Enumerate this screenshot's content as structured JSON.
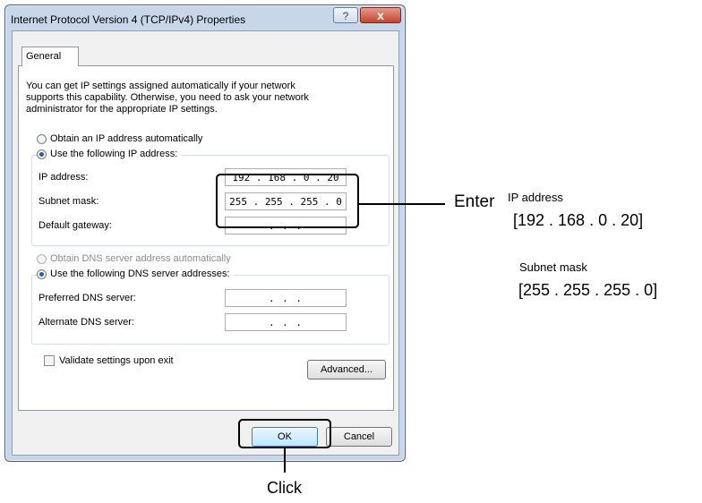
{
  "window": {
    "title": "Internet Protocol Version 4 (TCP/IPv4) Properties",
    "help_glyph": "?",
    "close_glyph": "x"
  },
  "tab": {
    "label": "General"
  },
  "description": "You can get IP settings assigned automatically if your network supports this capability. Otherwise, you need to ask your network administrator for the appropriate IP settings.",
  "ip": {
    "auto_label": "Obtain an IP address automatically",
    "manual_label": "Use the following IP address:",
    "address_label": "IP address:",
    "address_value": "192 . 168 .  0  . 20",
    "mask_label": "Subnet mask:",
    "mask_value": "255 . 255 . 255 .  0",
    "gateway_label": "Default gateway:",
    "gateway_value": ".     .     ."
  },
  "dns": {
    "auto_label": "Obtain DNS server address automatically",
    "manual_label": "Use the following DNS server addresses:",
    "preferred_label": "Preferred DNS server:",
    "preferred_value": ".     .     .",
    "alternate_label": "Alternate DNS server:",
    "alternate_value": ".     .     ."
  },
  "validate_label": "Validate settings upon exit",
  "buttons": {
    "advanced": "Advanced...",
    "ok": "OK",
    "cancel": "Cancel"
  },
  "annotations": {
    "enter": "Enter",
    "ip_heading": "IP address",
    "ip_value": "[192 . 168 . 0 . 20]",
    "mask_heading": "Subnet mask",
    "mask_value": "[255 . 255 . 255 . 0]",
    "click": "Click"
  }
}
